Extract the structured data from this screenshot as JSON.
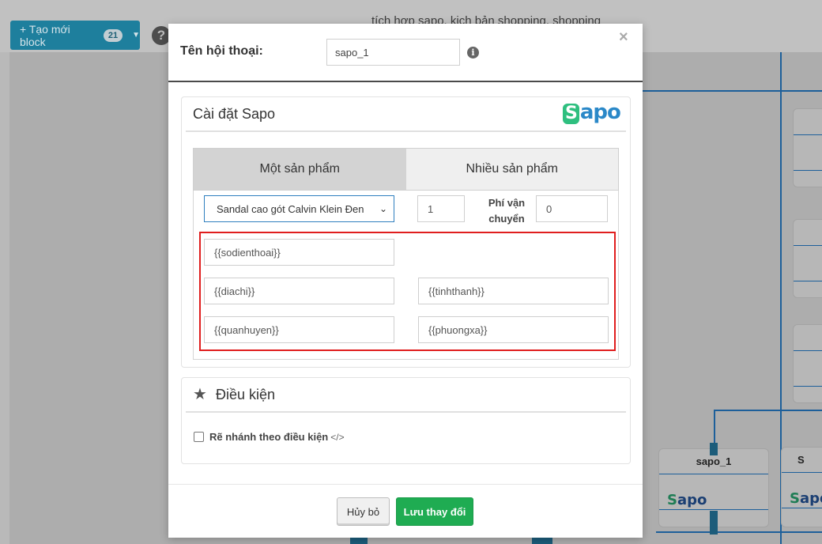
{
  "toolbar": {
    "new_block_label": "+ Tạo mới block",
    "new_block_count": "21",
    "help": "?"
  },
  "canvas": {
    "flow_title": "tích hợp sapo, kịch bản shopping, shopping",
    "node_title": "sapo_1",
    "node_logo_s": "S",
    "node_logo_rest": "apo",
    "node2_title": "S"
  },
  "dialog": {
    "conversation_label": "Tên hội thoại:",
    "conversation_value": "sapo_1",
    "info": "i",
    "close": "×",
    "sapo_section": {
      "title": "Cài đặt Sapo",
      "logo_s": "S",
      "logo_rest": "apo",
      "tabs": [
        {
          "label": "Một sản phẩm",
          "active": true
        },
        {
          "label": "Nhiều sản phẩm",
          "active": false
        }
      ],
      "product_select": "Sandal cao gót Calvin Klein Đen",
      "quantity": "1",
      "shipping_label": "Phí vận chuyển",
      "shipping_value": "0",
      "fields": {
        "phone": "{{sodienthoai}}",
        "address": "{{diachi}}",
        "city": "{{tinhthanh}}",
        "district": "{{quanhuyen}}",
        "ward": "{{phuongxa}}"
      }
    },
    "condition_section": {
      "title": "Điều kiện",
      "branch_label": "Rẽ nhánh theo điều kiện",
      "branch_checked": false
    },
    "buttons": {
      "cancel": "Hủy bỏ",
      "save": "Lưu thay đổi"
    }
  },
  "colors": {
    "accent_blue": "#2f7fbf",
    "save_green": "#1fac52",
    "highlight_red": "#e01e1e",
    "flow_line": "#1d5f9a"
  }
}
